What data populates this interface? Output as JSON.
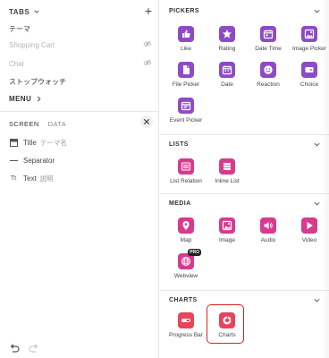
{
  "tabs": {
    "title": "TABS",
    "items": [
      {
        "label": "テーマ",
        "hidden": false
      },
      {
        "label": "Shopping Cart",
        "hidden": true
      },
      {
        "label": "Chat",
        "hidden": true
      },
      {
        "label": "ストップウォッチ",
        "hidden": false
      }
    ]
  },
  "menu": {
    "title": "MENU"
  },
  "screen": {
    "tab_screen": "SCREEN",
    "tab_data": "DATA",
    "components": [
      {
        "icon": "title-icon",
        "name": "Title",
        "sub": "テーマ名"
      },
      {
        "icon": "separator-icon",
        "name": "Separator",
        "sub": ""
      },
      {
        "icon": "text-icon",
        "icon_text": "Tt",
        "name": "Text",
        "sub": "説明"
      }
    ]
  },
  "sections": {
    "pickers": {
      "title": "PICKERS",
      "items": [
        "Like",
        "Rating",
        "Date Time",
        "Image Picker",
        "File Picker",
        "Date",
        "Reaction",
        "Choice",
        "Event Picker"
      ]
    },
    "lists": {
      "title": "LISTS",
      "items": [
        "List Relation",
        "Inline List"
      ]
    },
    "media": {
      "title": "MEDIA",
      "items": [
        "Map",
        "Image",
        "Audio",
        "Video",
        "Webview"
      ],
      "pro_badge": "PRO"
    },
    "charts": {
      "title": "CHARTS",
      "items": [
        "Progress Bar",
        "Charts"
      ]
    }
  },
  "colors": {
    "tile_pink": "#d63b8e",
    "tile_purple": "#8e4bc7",
    "tile_red": "#e6455c",
    "highlight": "#e02020"
  }
}
